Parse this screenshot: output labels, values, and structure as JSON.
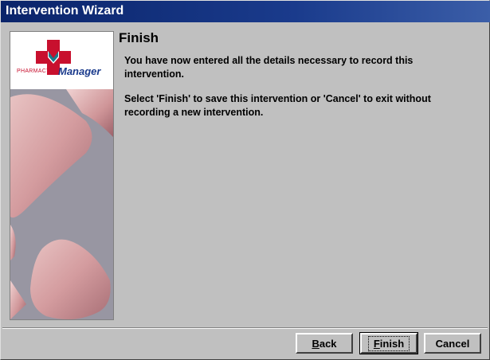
{
  "window": {
    "title": "Intervention Wizard"
  },
  "logo": {
    "brand_small": "PHARMACY",
    "brand_big": "Manager"
  },
  "content": {
    "heading": "Finish",
    "paragraph1": "You have now entered all the details necessary to record this intervention.",
    "paragraph2": "Select 'Finish' to save this intervention or 'Cancel' to exit without recording a new intervention."
  },
  "buttons": {
    "back_rest": "ack",
    "back_mnemonic": "B",
    "finish_rest": "inish",
    "finish_mnemonic": "F",
    "cancel": "Cancel"
  },
  "colors": {
    "titlebar": "#0a246a",
    "dialog_bg": "#c0c0c0",
    "logo_red": "#c8102e",
    "logo_blue": "#1a3a8c"
  }
}
